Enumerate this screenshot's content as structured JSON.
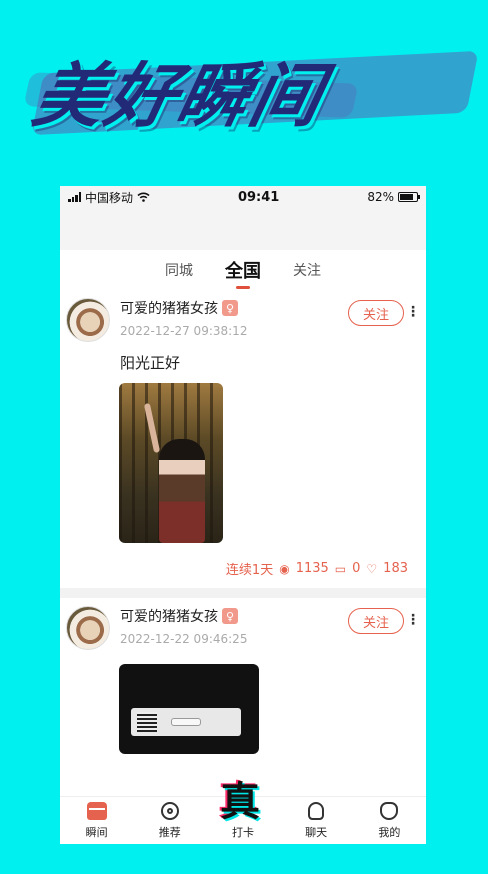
{
  "banner": {
    "title": "美好瞬间"
  },
  "status_bar": {
    "carrier": "中国移动",
    "time": "09:41",
    "battery": "82%"
  },
  "tabs": [
    {
      "label": "同城"
    },
    {
      "label": "全国",
      "active": true
    },
    {
      "label": "关注"
    }
  ],
  "posts": [
    {
      "username": "可爱的猪猪女孩",
      "gender_icon": "female-icon",
      "timestamp": "2022-12-27 09:38:12",
      "follow_label": "关注",
      "text": "阳光正好",
      "streak": "连续1天",
      "views": "1135",
      "comments": "0",
      "likes": "183"
    },
    {
      "username": "可爱的猪猪女孩",
      "gender_icon": "female-icon",
      "timestamp": "2022-12-22 09:46:25",
      "follow_label": "关注"
    }
  ],
  "tabbar": {
    "items": [
      {
        "label": "瞬间",
        "icon": "moments-icon",
        "active": true
      },
      {
        "label": "推荐",
        "icon": "location-icon"
      },
      {
        "label": "打卡",
        "icon": "zhen-badge",
        "badge_text": "真"
      },
      {
        "label": "聊天",
        "icon": "chat-bulb-icon"
      },
      {
        "label": "我的",
        "icon": "profile-icon"
      }
    ]
  },
  "colors": {
    "background": "#00f0f0",
    "accent": "#e5624e",
    "banner_text": "#222a78"
  }
}
